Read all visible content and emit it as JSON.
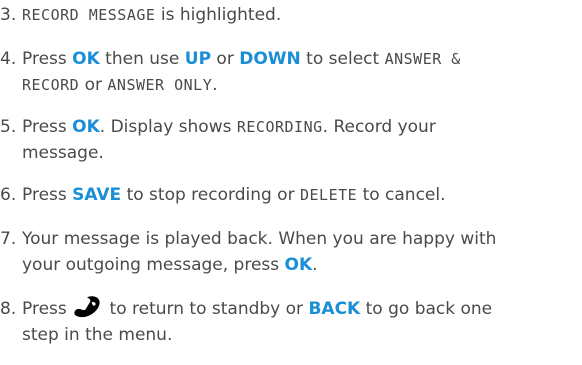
{
  "steps": [
    {
      "num": "3.",
      "lines": [
        {
          "mono1": "RECORD MESSAGE",
          "t1": " is highlighted."
        }
      ]
    },
    {
      "num": "4.",
      "lines": [
        {
          "t1": "Press ",
          "k1": "OK",
          "t2": " then use ",
          "k2": "UP",
          "t3": " or ",
          "k3": "DOWN",
          "t4": " to select ",
          "mono1": "ANSWER &"
        },
        {
          "mono1": "RECORD",
          "t1": " or ",
          "mono2": "ANSWER ONLY",
          "t2": "."
        }
      ]
    },
    {
      "num": "5.",
      "lines": [
        {
          "t1": "Press ",
          "k1": "OK",
          "t2": ". Display shows ",
          "mono1": "RECORDING",
          "t3": ". Record your"
        },
        {
          "t1": "message."
        }
      ]
    },
    {
      "num": "6.",
      "lines": [
        {
          "t1": "Press ",
          "k1": "SAVE",
          "t2": " to stop recording or ",
          "mono1": "DELETE",
          "t3": " to cancel."
        }
      ]
    },
    {
      "num": "7.",
      "lines": [
        {
          "t1": "Your message is played back. When you are happy with"
        },
        {
          "t1": "your outgoing message, press ",
          "k1": "OK",
          "t2": "."
        }
      ]
    },
    {
      "num": "8.",
      "lines": [
        {
          "t1": "Press ",
          "icon": "end-call-handset-icon",
          "t2": " to return to standby or ",
          "k1": "BACK",
          "t3": " to go back one"
        },
        {
          "t1": "step in the menu."
        }
      ]
    }
  ],
  "colors": {
    "text": "#4a4a4a",
    "key": "#1a8fd6"
  }
}
